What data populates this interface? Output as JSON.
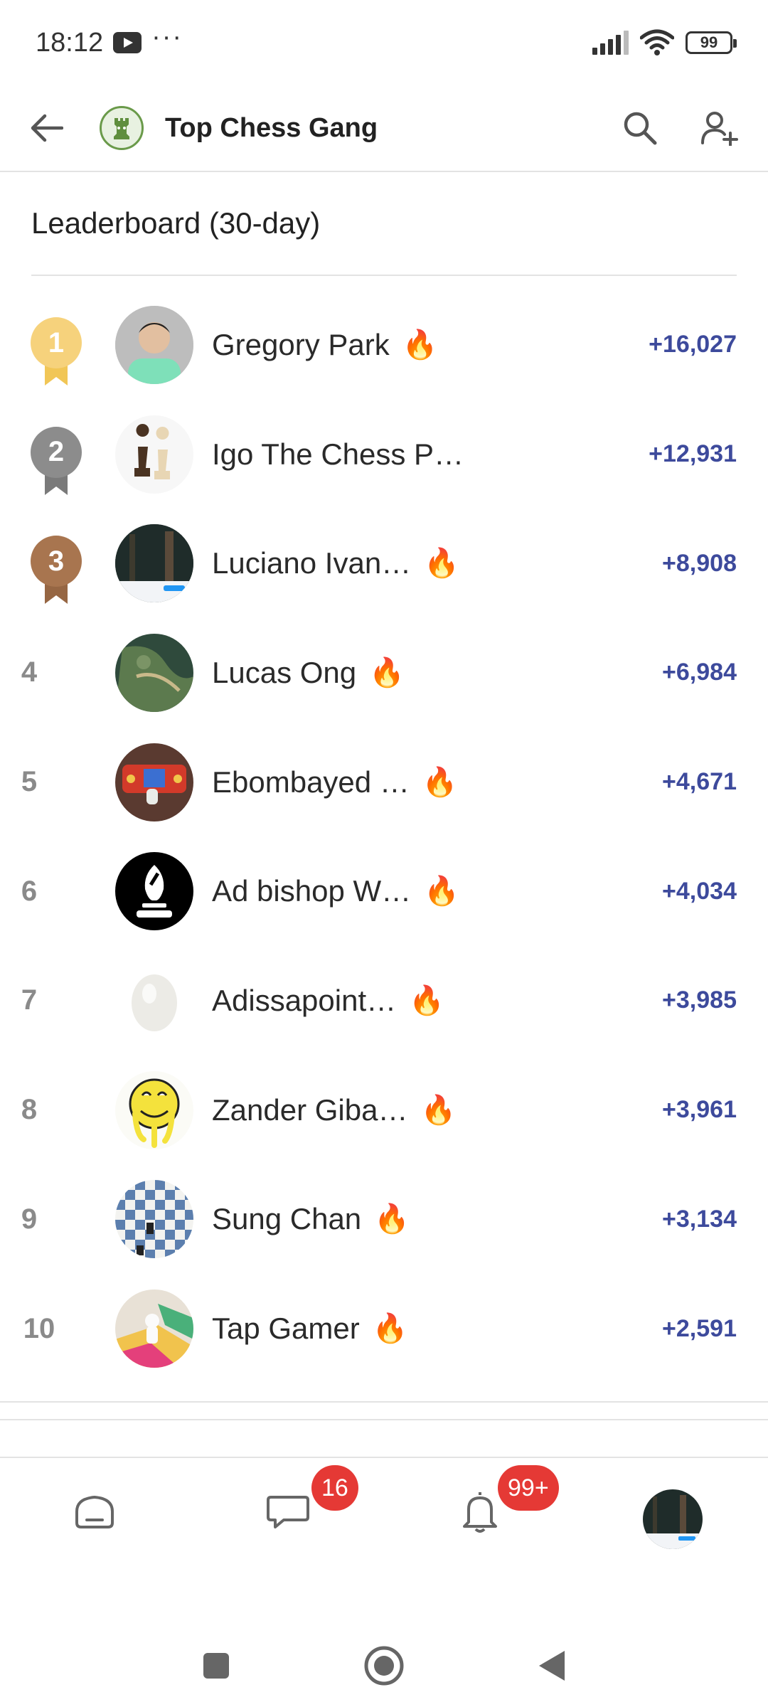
{
  "status_bar": {
    "time": "18:12",
    "more_indicator": "···",
    "battery": "99",
    "icons": [
      "youtube-notification-icon",
      "signal-icon",
      "wifi-icon",
      "battery-icon"
    ]
  },
  "app_bar": {
    "title": "Top Chess Gang",
    "icons": [
      "back-arrow-icon",
      "club-logo",
      "search-icon",
      "add-member-icon"
    ]
  },
  "leaderboard": {
    "title": "Leaderboard (30-day)",
    "rows": [
      {
        "rank": "1",
        "name": "Gregory Park",
        "streak": "🔥",
        "score": "+16,027"
      },
      {
        "rank": "2",
        "name": "Igo The Chess P…",
        "streak": "",
        "score": "+12,931"
      },
      {
        "rank": "3",
        "name": "Luciano Ivan…",
        "streak": "🔥",
        "score": "+8,908"
      },
      {
        "rank": "4",
        "name": "Lucas Ong",
        "streak": "🔥",
        "score": "+6,984"
      },
      {
        "rank": "5",
        "name": "Ebombayed …",
        "streak": "🔥",
        "score": "+4,671"
      },
      {
        "rank": "6",
        "name": "Ad bishop W…",
        "streak": "🔥",
        "score": "+4,034"
      },
      {
        "rank": "7",
        "name": "Adissapoint…",
        "streak": "🔥",
        "score": "+3,985"
      },
      {
        "rank": "8",
        "name": "Zander Giba…",
        "streak": "🔥",
        "score": "+3,961"
      },
      {
        "rank": "9",
        "name": "Sung Chan",
        "streak": "🔥",
        "score": "+3,134"
      },
      {
        "rank": "10",
        "name": "Tap Gamer",
        "streak": "🔥",
        "score": "+2,591"
      }
    ],
    "medal_colors": {
      "gold": "#f6d27c",
      "silver": "#8c8c8c",
      "bronze": "#a8754f"
    }
  },
  "tab_bar": {
    "tabs": [
      {
        "name": "home",
        "icon": "home-icon",
        "badge": ""
      },
      {
        "name": "messages",
        "icon": "chat-icon",
        "badge": "16"
      },
      {
        "name": "notifications",
        "icon": "bell-icon",
        "badge": "99+"
      },
      {
        "name": "profile",
        "icon": "avatar",
        "badge": ""
      }
    ]
  },
  "system_nav": {
    "icons": [
      "recents-square-icon",
      "home-circle-icon",
      "back-triangle-icon"
    ]
  },
  "colors": {
    "score": "#3d4a9c",
    "badge": "#e53935",
    "divider": "#e3e3e3"
  }
}
